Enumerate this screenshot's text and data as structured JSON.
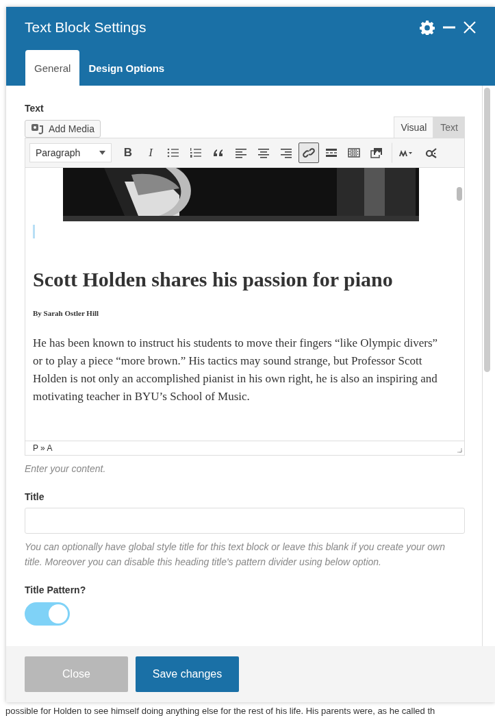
{
  "window": {
    "title": "Text Block Settings"
  },
  "tabs": [
    {
      "label": "General",
      "selected": true
    },
    {
      "label": "Design Options",
      "selected": false
    }
  ],
  "text_field": {
    "label": "Text",
    "add_media": "Add Media",
    "editor_tabs": [
      {
        "label": "Visual",
        "selected": true
      },
      {
        "label": "Text",
        "selected": false
      }
    ],
    "toolbar": [
      {
        "kind": "format",
        "label": "Paragraph"
      },
      {
        "kind": "bold",
        "label": "B",
        "selected": false
      },
      {
        "kind": "italic",
        "label": "I",
        "selected": false
      },
      {
        "kind": "bullets",
        "selected": false
      },
      {
        "kind": "numbers",
        "selected": false
      },
      {
        "kind": "quote",
        "selected": false
      },
      {
        "kind": "align-left",
        "selected": false
      },
      {
        "kind": "align-center",
        "selected": false
      },
      {
        "kind": "align-right",
        "selected": false
      },
      {
        "kind": "link",
        "selected": true
      },
      {
        "kind": "more",
        "selected": false
      },
      {
        "kind": "toolbar",
        "selected": false
      },
      {
        "kind": "media",
        "selected": false
      },
      {
        "kind": "m-menu",
        "selected": false
      },
      {
        "kind": "shortcode",
        "selected": false
      }
    ],
    "content": {
      "heading": "Scott Holden shares his passion for piano",
      "byline": "By Sarah Ostler Hill",
      "paragraph": "He has been known to instruct his students to move their fingers “like Olympic divers” or to play a piece “more brown.” His tactics may sound strange, but Professor Scott Holden is not only an accomplished pianist in his own right, he is also an inspiring and motivating teacher in BYU’s School of Music."
    },
    "path": "P » A",
    "help": "Enter your content."
  },
  "title_field": {
    "label": "Title",
    "help": "You can optionally have global style title for this text block or leave this blank if you create your own title. Moreover you can disable this heading title's pattern divider using below option."
  },
  "title_pattern": {
    "label": "Title Pattern?",
    "on": true
  },
  "buttons": [
    {
      "label": "Close",
      "kind": "secondary"
    },
    {
      "label": "Save changes",
      "kind": "primary"
    }
  ],
  "background_text": "possible for Holden to see himself doing anything else for the rest of his life. His parents were, as he called th"
}
